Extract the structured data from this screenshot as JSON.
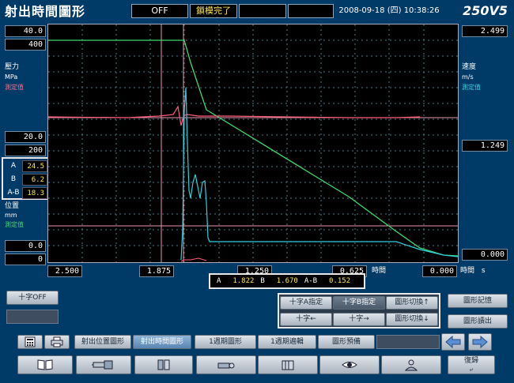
{
  "header": {
    "title": "射出時間圖形",
    "status_off": "OFF",
    "status_mold": "鎖模完了",
    "date": "2008-09-18",
    "weekday": "(四)",
    "time": "10:38:26",
    "model": "250V5"
  },
  "left_axis": {
    "pressure_max": "40.0",
    "pressure_max2": "400",
    "pressure_label": "壓力",
    "pressure_unit": "MPa",
    "pressure_measured": "測定值",
    "pressure_mid": "20.0",
    "pressure_mid2": "200",
    "position_label": "位置",
    "position_unit": "mm",
    "position_measured": "測定值",
    "position_zero": "0.0",
    "position_zero2": "0"
  },
  "right_axis": {
    "speed_max": "2.499",
    "speed_label": "速度",
    "speed_unit": "m/s",
    "speed_measured": "測定值",
    "speed_mid": "1.249",
    "speed_zero": "0.000"
  },
  "cursor_values": {
    "a_label": "A",
    "a_value": "24.5",
    "b_label": "B",
    "b_value": "6.2",
    "ab_label": "A-B",
    "ab_value": "18.3"
  },
  "time_axis": {
    "ticks": [
      "2.500",
      "1.875",
      "1.250",
      "0.625"
    ],
    "end_value": "0.000",
    "label": "時間",
    "right_label": "時間",
    "unit": "s"
  },
  "time_readout": {
    "a_label": "A",
    "a_value": "1.822",
    "b_label": "B",
    "b_value": "1.670",
    "ab_label": "A-B",
    "ab_value": "0.152"
  },
  "buttons": {
    "crosshair_off": "十字OFF",
    "cross_a": "十字A指定",
    "cross_b": "十字B指定",
    "graph_switch_up": "圖形切換↑",
    "cross_left": "十字←",
    "cross_right": "十字→",
    "graph_switch_down": "圖形切換↓",
    "graph_memory": "圖形記憶",
    "graph_recall": "圖形讀出",
    "restore": "復歸"
  },
  "tabs": [
    {
      "label": "射出位置圖形"
    },
    {
      "label": "射出時間圖形"
    },
    {
      "label": "1週期圖形"
    },
    {
      "label": "1週期遍輯"
    },
    {
      "label": "圖形預備"
    }
  ],
  "colors": {
    "pressure": "#ff5c7a",
    "speed": "#2ed0de",
    "position": "#3fd870",
    "grid": "#4f7a86",
    "background": "#003a66"
  }
}
